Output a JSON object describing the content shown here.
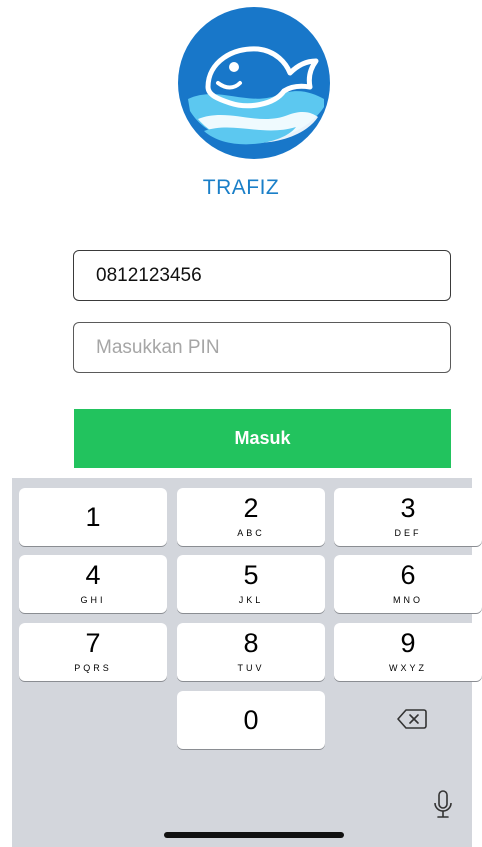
{
  "app": {
    "name": "TRAFIZ"
  },
  "login": {
    "phone_value": "0812123456",
    "pin_placeholder": "Masukkan PIN",
    "submit_label": "Masuk"
  },
  "keypad": {
    "keys": [
      {
        "digit": "1",
        "letters": ""
      },
      {
        "digit": "2",
        "letters": "ABC"
      },
      {
        "digit": "3",
        "letters": "DEF"
      },
      {
        "digit": "4",
        "letters": "GHI"
      },
      {
        "digit": "5",
        "letters": "JKL"
      },
      {
        "digit": "6",
        "letters": "MNO"
      },
      {
        "digit": "7",
        "letters": "PQRS"
      },
      {
        "digit": "8",
        "letters": "TUV"
      },
      {
        "digit": "9",
        "letters": "WXYZ"
      },
      {
        "digit": "0",
        "letters": ""
      }
    ],
    "icons": {
      "backspace": "backspace-icon",
      "mic": "microphone-icon"
    }
  },
  "colors": {
    "brand_blue": "#1a7fc8",
    "button_green": "#22c35e",
    "keyboard_bg": "#d3d6dc"
  }
}
